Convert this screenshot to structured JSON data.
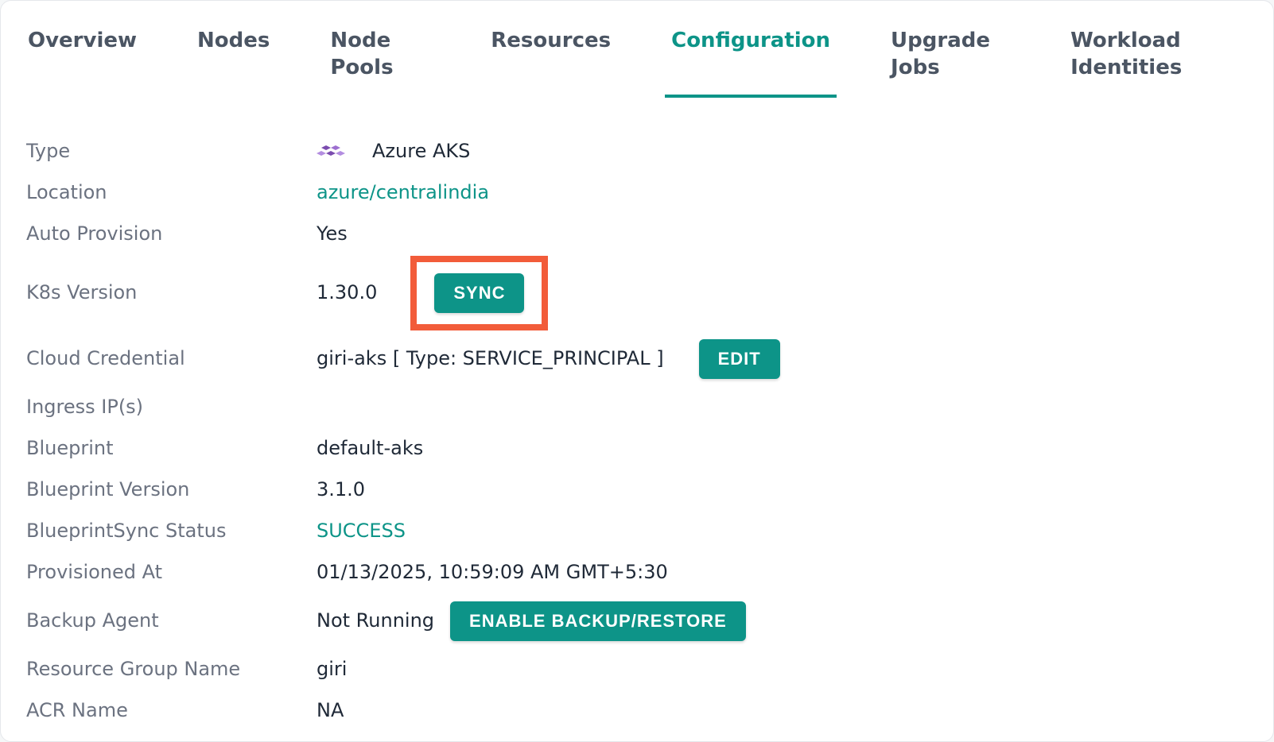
{
  "tabs": [
    {
      "label": "Overview"
    },
    {
      "label": "Nodes"
    },
    {
      "label": "Node Pools"
    },
    {
      "label": "Resources"
    },
    {
      "label": "Configuration"
    },
    {
      "label": "Upgrade Jobs"
    },
    {
      "label": "Workload Identities"
    }
  ],
  "active_tab_index": 4,
  "rows": {
    "type": {
      "label": "Type",
      "value": "Azure AKS"
    },
    "location": {
      "label": "Location",
      "value": "azure/centralindia"
    },
    "auto_provision": {
      "label": "Auto Provision",
      "value": "Yes"
    },
    "k8s_version": {
      "label": "K8s Version",
      "value": "1.30.0"
    },
    "cloud_credential": {
      "label": "Cloud Credential",
      "value": "giri-aks [ Type: SERVICE_PRINCIPAL ]"
    },
    "ingress_ips": {
      "label": "Ingress IP(s)",
      "value": ""
    },
    "blueprint": {
      "label": "Blueprint",
      "value": "default-aks"
    },
    "blueprint_ver": {
      "label": "Blueprint Version",
      "value": "3.1.0"
    },
    "bp_sync_status": {
      "label": "BlueprintSync Status",
      "value": "SUCCESS"
    },
    "provisioned_at": {
      "label": "Provisioned At",
      "value": "01/13/2025, 10:59:09 AM GMT+5:30"
    },
    "backup_agent": {
      "label": "Backup Agent",
      "value": "Not Running"
    },
    "rg_name": {
      "label": "Resource Group Name",
      "value": "giri"
    },
    "acr_name": {
      "label": "ACR Name",
      "value": "NA"
    }
  },
  "buttons": {
    "sync": "SYNC",
    "edit": "EDIT",
    "enable_backup": "ENABLE BACKUP/RESTORE"
  }
}
